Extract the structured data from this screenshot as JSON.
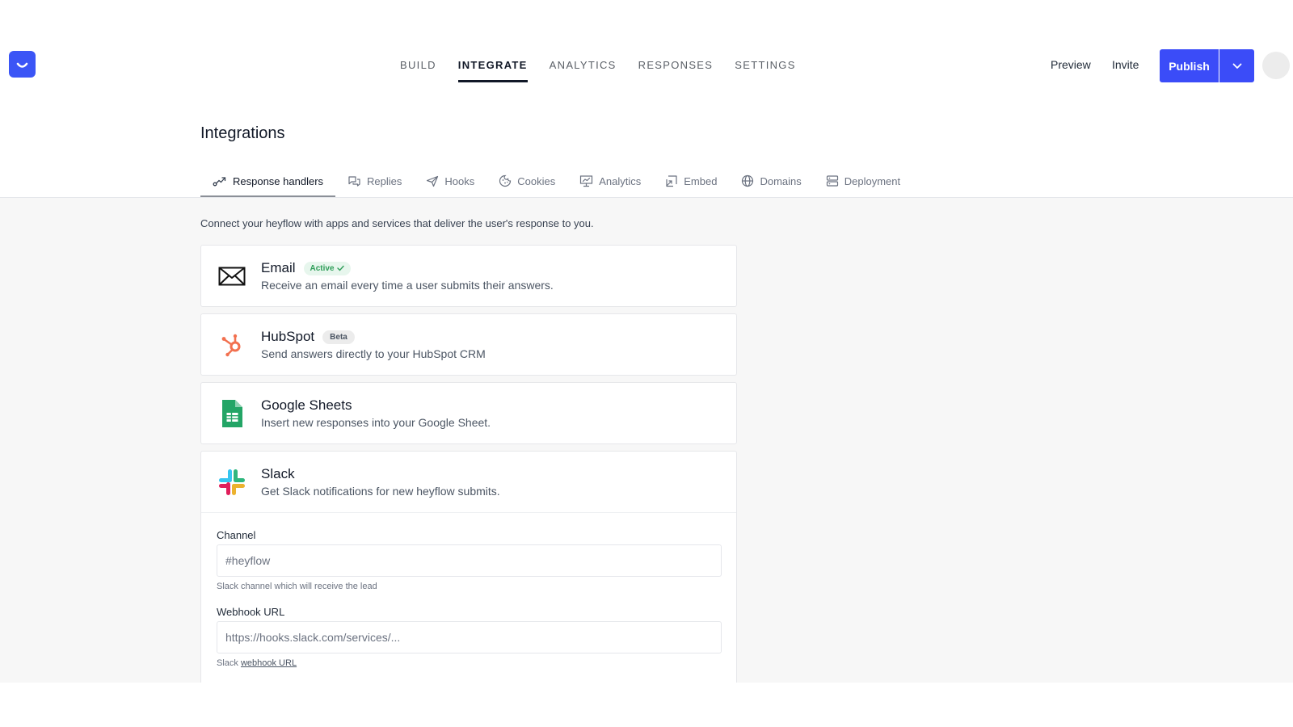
{
  "nav": {
    "tabs": [
      {
        "label": "BUILD"
      },
      {
        "label": "INTEGRATE"
      },
      {
        "label": "ANALYTICS"
      },
      {
        "label": "RESPONSES"
      },
      {
        "label": "SETTINGS"
      }
    ],
    "active_tab": "INTEGRATE",
    "preview_label": "Preview",
    "invite_label": "Invite",
    "publish_label": "Publish",
    "brand_color": "#3b4cf8"
  },
  "page": {
    "title": "Integrations",
    "subtabs": [
      {
        "label": "Response handlers",
        "icon": "route-icon"
      },
      {
        "label": "Replies",
        "icon": "chat-bubbles-icon"
      },
      {
        "label": "Hooks",
        "icon": "send-icon"
      },
      {
        "label": "Cookies",
        "icon": "cookie-icon"
      },
      {
        "label": "Analytics",
        "icon": "presentation-chart-icon"
      },
      {
        "label": "Embed",
        "icon": "embed-icon"
      },
      {
        "label": "Domains",
        "icon": "globe-icon"
      },
      {
        "label": "Deployment",
        "icon": "server-icon"
      }
    ],
    "active_subtab": "Response handlers",
    "intro": "Connect your heyflow with apps and services that deliver the user's response to you."
  },
  "integrations": [
    {
      "name": "Email",
      "badge": "Active",
      "description": "Receive an email every time a user submits their answers.",
      "icon": "envelope-icon"
    },
    {
      "name": "HubSpot",
      "badge": "Beta",
      "description": "Send answers directly to your HubSpot CRM",
      "icon": "hubspot-icon"
    },
    {
      "name": "Google Sheets",
      "description": "Insert new responses into your Google Sheet.",
      "icon": "google-sheets-icon"
    },
    {
      "name": "Slack",
      "description": "Get Slack notifications for new heyflow submits.",
      "icon": "slack-icon"
    }
  ],
  "slack_form": {
    "channel_label": "Channel",
    "channel_placeholder": "#heyflow",
    "channel_hint": "Slack channel which will receive the lead",
    "webhook_label": "Webhook URL",
    "webhook_placeholder": "https://hooks.slack.com/services/...",
    "webhook_hint_prefix": "Slack",
    "webhook_hint_link": "webhook URL"
  }
}
